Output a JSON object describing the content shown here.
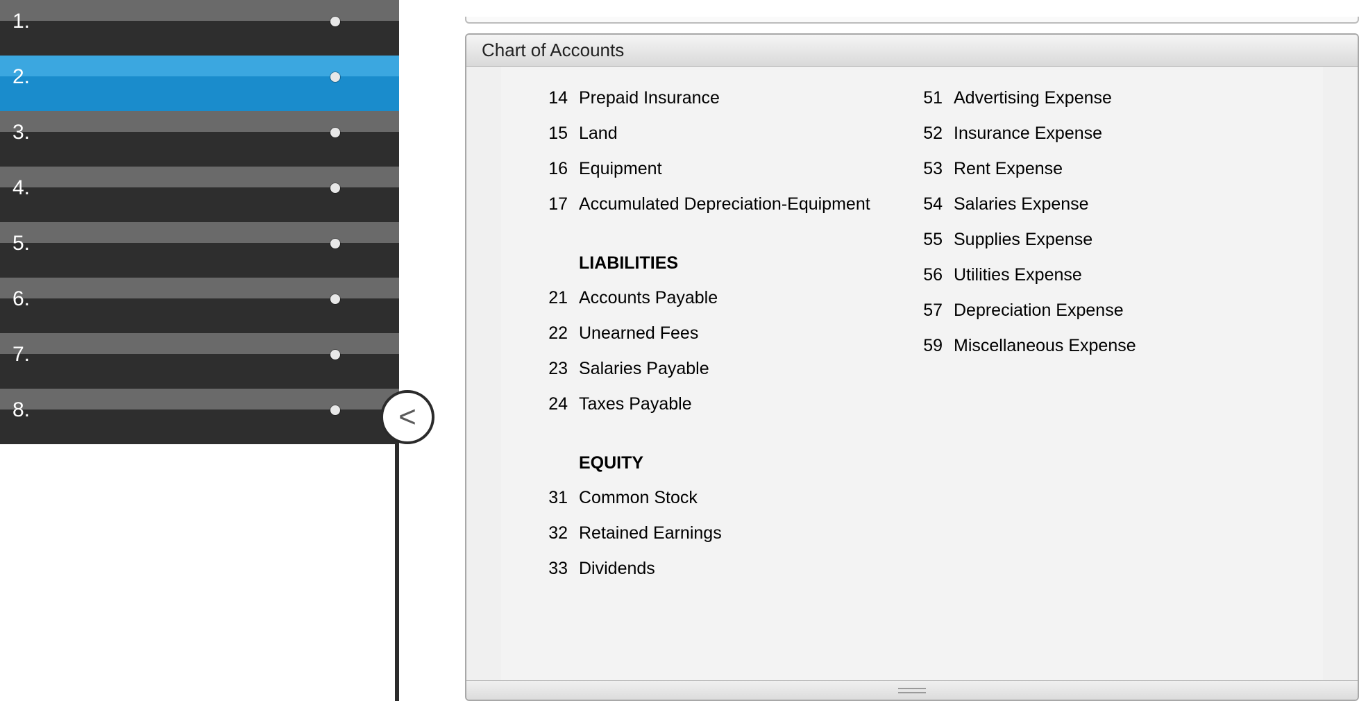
{
  "sidebar": {
    "selectedIndex": 1,
    "items": [
      {
        "label": "1."
      },
      {
        "label": "2."
      },
      {
        "label": "3."
      },
      {
        "label": "4."
      },
      {
        "label": "5."
      },
      {
        "label": "6."
      },
      {
        "label": "7."
      },
      {
        "label": "8."
      }
    ],
    "collapseGlyph": "<"
  },
  "panel": {
    "title": "Chart of Accounts"
  },
  "chart_of_accounts": {
    "left_column": [
      {
        "type": "row",
        "num": "14",
        "name": "Prepaid Insurance"
      },
      {
        "type": "row",
        "num": "15",
        "name": "Land"
      },
      {
        "type": "row",
        "num": "16",
        "name": "Equipment"
      },
      {
        "type": "row",
        "num": "17",
        "name": "Accumulated Depreciation-Equipment"
      },
      {
        "type": "head",
        "name": "LIABILITIES"
      },
      {
        "type": "row",
        "num": "21",
        "name": "Accounts Payable"
      },
      {
        "type": "row",
        "num": "22",
        "name": "Unearned Fees"
      },
      {
        "type": "row",
        "num": "23",
        "name": "Salaries Payable"
      },
      {
        "type": "row",
        "num": "24",
        "name": "Taxes Payable"
      },
      {
        "type": "head",
        "name": "EQUITY"
      },
      {
        "type": "row",
        "num": "31",
        "name": "Common Stock"
      },
      {
        "type": "row",
        "num": "32",
        "name": "Retained Earnings"
      },
      {
        "type": "row",
        "num": "33",
        "name": "Dividends"
      }
    ],
    "right_column": [
      {
        "type": "row",
        "num": "51",
        "name": "Advertising Expense"
      },
      {
        "type": "row",
        "num": "52",
        "name": "Insurance Expense"
      },
      {
        "type": "row",
        "num": "53",
        "name": "Rent Expense"
      },
      {
        "type": "row",
        "num": "54",
        "name": "Salaries Expense"
      },
      {
        "type": "row",
        "num": "55",
        "name": "Supplies Expense"
      },
      {
        "type": "row",
        "num": "56",
        "name": "Utilities Expense"
      },
      {
        "type": "row",
        "num": "57",
        "name": "Depreciation Expense"
      },
      {
        "type": "row",
        "num": "59",
        "name": "Miscellaneous Expense"
      }
    ]
  }
}
